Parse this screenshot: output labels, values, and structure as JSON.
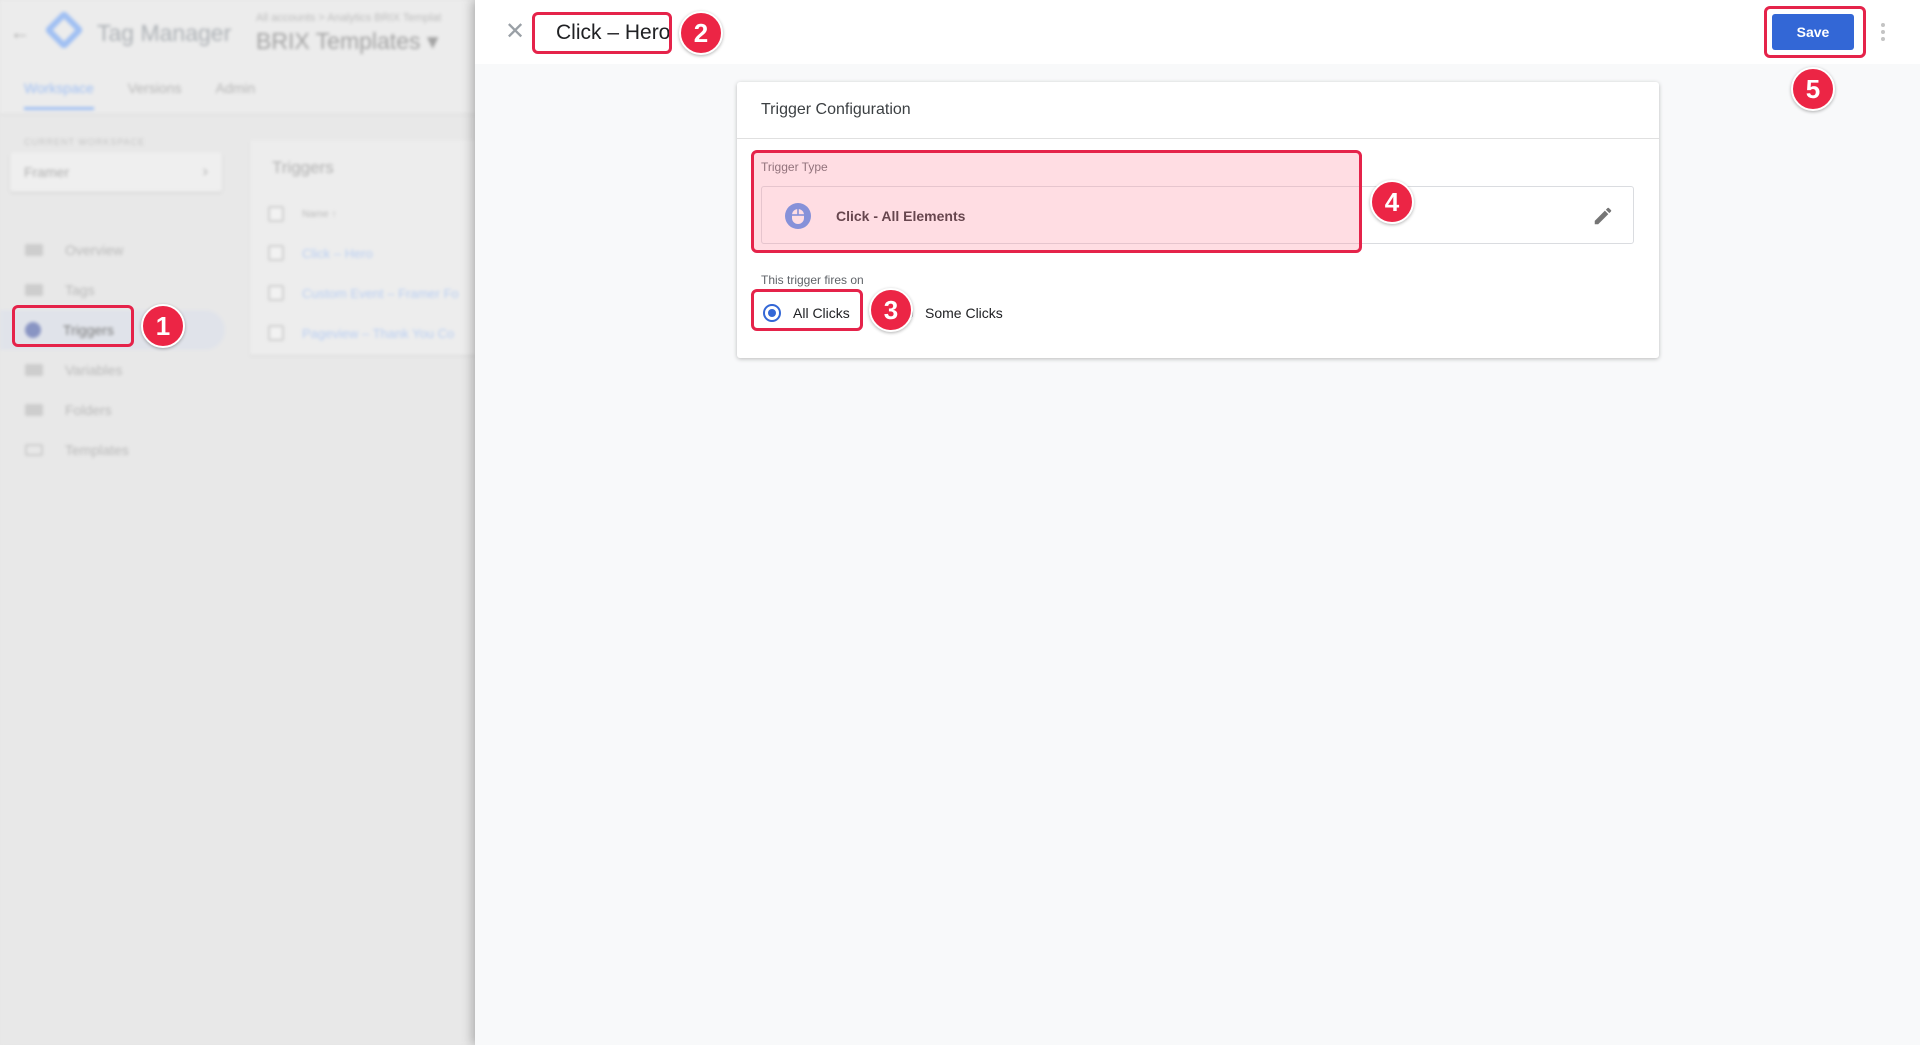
{
  "background": {
    "app_name": "Tag Manager",
    "breadcrumb": "All accounts > Analytics BRIX Templat",
    "container_name": "BRIX Templates ▾",
    "nav_tabs": [
      "Workspace",
      "Versions",
      "Admin"
    ],
    "workspace_label": "CURRENT WORKSPACE",
    "workspace_name": "Framer",
    "sidebar": [
      {
        "label": "Overview"
      },
      {
        "label": "Tags"
      },
      {
        "label": "Triggers"
      },
      {
        "label": "Variables"
      },
      {
        "label": "Folders"
      },
      {
        "label": "Templates"
      }
    ],
    "triggers_list": {
      "title": "Triggers",
      "column_name": "Name ↑",
      "rows": [
        "Click – Hero",
        "Custom Event – Framer Fo",
        "Pageview – Thank You Co"
      ]
    }
  },
  "panel": {
    "trigger_name": "Click – Hero",
    "save_label": "Save",
    "card_title": "Trigger Configuration",
    "trigger_type_label": "Trigger Type",
    "trigger_type_name": "Click - All Elements",
    "fires_on_label": "This trigger fires on",
    "radio_options": [
      "All Clicks",
      "Some Clicks"
    ],
    "selected_option": "All Clicks"
  },
  "annotations": [
    "1",
    "2",
    "3",
    "4",
    "5"
  ],
  "colors": {
    "accent": "#3367d6",
    "highlight": "#e5234a",
    "badge": "#ec2545"
  }
}
